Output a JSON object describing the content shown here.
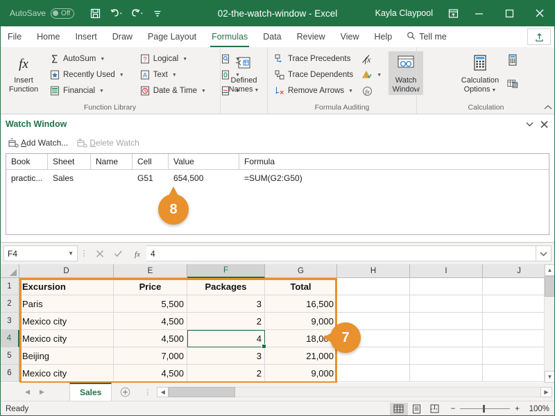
{
  "titlebar": {
    "autosave_label": "AutoSave",
    "autosave_state": "Off",
    "document_title": "02-the-watch-window  -  Excel",
    "username": "Kayla Claypool",
    "qat": [
      {
        "name": "save-icon",
        "label": "Save"
      },
      {
        "name": "undo-icon",
        "label": "Undo"
      },
      {
        "name": "redo-icon",
        "label": "Redo"
      },
      {
        "name": "customize-qat-icon",
        "label": "Customize Quick Access Toolbar"
      }
    ],
    "window_controls": [
      {
        "name": "ribbon-display-options-icon",
        "label": "Ribbon Display Options"
      },
      {
        "name": "minimize-icon",
        "label": "Minimize"
      },
      {
        "name": "restore-icon",
        "label": "Restore Down"
      },
      {
        "name": "close-icon",
        "label": "Close"
      }
    ]
  },
  "ribbon_tabs": [
    {
      "label": "File",
      "active": false
    },
    {
      "label": "Home",
      "active": false
    },
    {
      "label": "Insert",
      "active": false
    },
    {
      "label": "Draw",
      "active": false
    },
    {
      "label": "Page Layout",
      "active": false
    },
    {
      "label": "Formulas",
      "active": true
    },
    {
      "label": "Data",
      "active": false
    },
    {
      "label": "Review",
      "active": false
    },
    {
      "label": "View",
      "active": false
    },
    {
      "label": "Help",
      "active": false
    }
  ],
  "tellme": {
    "label": "Tell me",
    "icon": "search-icon"
  },
  "share": {
    "label": "Share",
    "icon": "share-icon"
  },
  "ribbon": {
    "groups": [
      {
        "title": "Function Library",
        "big_button": {
          "label_line1": "Insert",
          "label_line2": "Function",
          "icon": "fx-icon"
        },
        "items": [
          {
            "label": "AutoSum",
            "icon": "sigma-icon",
            "has_caret": true
          },
          {
            "label": "Recently Used",
            "icon": "star-icon",
            "has_caret": true
          },
          {
            "label": "Financial",
            "icon": "financial-icon",
            "has_caret": true
          },
          {
            "label": "Logical",
            "icon": "logical-icon",
            "has_caret": true
          },
          {
            "label": "Text",
            "icon": "text-icon",
            "has_caret": true
          },
          {
            "label": "Date & Time",
            "icon": "clock-icon",
            "has_caret": true
          },
          {
            "label": "",
            "icon": "lookup-reference-icon",
            "has_caret": true
          },
          {
            "label": "",
            "icon": "math-trig-icon",
            "has_caret": true
          },
          {
            "label": "",
            "icon": "more-functions-icon",
            "has_caret": true
          }
        ]
      },
      {
        "title": "",
        "big_button": {
          "label_line1": "Defined",
          "label_line2": "Names",
          "icon": "defined-names-icon",
          "has_caret": true
        },
        "items": []
      },
      {
        "title": "Formula Auditing",
        "items": [
          {
            "label": "Trace Precedents",
            "icon": "trace-precedents-icon",
            "has_caret": false
          },
          {
            "label": "Trace Dependents",
            "icon": "trace-dependents-icon",
            "has_caret": false
          },
          {
            "label": "Remove Arrows",
            "icon": "remove-arrows-icon",
            "has_caret": true
          },
          {
            "label": "",
            "icon": "show-formulas-icon",
            "has_caret": false
          },
          {
            "label": "",
            "icon": "error-checking-icon",
            "has_caret": true
          },
          {
            "label": "",
            "icon": "evaluate-formula-icon",
            "has_caret": false
          }
        ],
        "watch_window": {
          "label_line1": "Watch",
          "label_line2": "Window",
          "icon": "watch-window-icon",
          "active": true
        }
      },
      {
        "title": "Calculation",
        "big_button": {
          "label_line1": "Calculation",
          "label_line2": "Options",
          "icon": "calculation-options-icon",
          "has_caret": true
        },
        "items": [
          {
            "label": "",
            "icon": "calculate-now-icon",
            "has_caret": false
          },
          {
            "label": "",
            "icon": "calculate-sheet-icon",
            "has_caret": false
          }
        ]
      }
    ],
    "collapse_label": "Collapse the Ribbon"
  },
  "watch_window": {
    "title": "Watch Window",
    "header_buttons": [
      {
        "name": "watch-window-options-icon",
        "label": "Options"
      },
      {
        "name": "watch-window-close-icon",
        "label": "Close"
      }
    ],
    "toolbar": [
      {
        "label": "Add Watch...",
        "enabled": true,
        "icon": "add-watch-icon"
      },
      {
        "label": "Delete Watch",
        "enabled": false,
        "icon": "delete-watch-icon"
      }
    ],
    "columns": [
      "Book",
      "Sheet",
      "Name",
      "Cell",
      "Value",
      "Formula"
    ],
    "rows": [
      {
        "book": "practic...",
        "sheet": "Sales",
        "name": "",
        "cell": "G51",
        "value": "654,500",
        "formula": "=SUM(G2:G50)"
      }
    ]
  },
  "formula_bar": {
    "name_box_value": "F4",
    "cancel_label": "Cancel",
    "enter_label": "Enter",
    "insert_function_label": "Insert Function",
    "formula_value": "4",
    "expand_label": "Expand Formula Bar"
  },
  "sheet": {
    "column_headers": [
      {
        "label": "D",
        "selected": false
      },
      {
        "label": "E",
        "selected": false
      },
      {
        "label": "F",
        "selected": true
      },
      {
        "label": "G",
        "selected": false
      },
      {
        "label": "H",
        "selected": false
      },
      {
        "label": "I",
        "selected": false
      },
      {
        "label": "J",
        "selected": false
      }
    ],
    "rows": [
      {
        "num": "1",
        "selected": false,
        "cells": [
          "Excursion",
          "Price",
          "Packages",
          "Total",
          "",
          "",
          ""
        ]
      },
      {
        "num": "2",
        "selected": false,
        "cells": [
          "Paris",
          "5,500",
          "3",
          "16,500",
          "",
          "",
          ""
        ]
      },
      {
        "num": "3",
        "selected": false,
        "cells": [
          "Mexico city",
          "4,500",
          "2",
          "9,000",
          "",
          "",
          ""
        ]
      },
      {
        "num": "4",
        "selected": true,
        "cells": [
          "Mexico city",
          "4,500",
          "4",
          "18,000",
          "",
          "",
          ""
        ]
      },
      {
        "num": "5",
        "selected": false,
        "cells": [
          "Beijing",
          "7,000",
          "3",
          "21,000",
          "",
          "",
          ""
        ]
      },
      {
        "num": "6",
        "selected": false,
        "cells": [
          "Mexico city",
          "4,500",
          "2",
          "9,000",
          "",
          "",
          ""
        ]
      }
    ],
    "active_cell": "F4",
    "tabs": [
      {
        "label": "Sales",
        "active": true
      }
    ],
    "add_sheet_label": "New sheet"
  },
  "status_bar": {
    "status": "Ready",
    "views": [
      {
        "name": "normal-view-icon",
        "label": "Normal",
        "active": true
      },
      {
        "name": "page-layout-view-icon",
        "label": "Page Layout",
        "active": false
      },
      {
        "name": "page-break-preview-icon",
        "label": "Page Break Preview",
        "active": false
      }
    ],
    "zoom_out_label": "Zoom Out",
    "zoom_in_label": "Zoom In",
    "zoom_level": "100%"
  },
  "callouts": [
    {
      "number": "7",
      "direction": "left"
    },
    {
      "number": "8",
      "direction": "up"
    }
  ],
  "colors": {
    "excel_green": "#217346",
    "callout_orange": "#e8912d",
    "data_outline": "#e8912d",
    "active_cell_border": "#1e7145"
  }
}
